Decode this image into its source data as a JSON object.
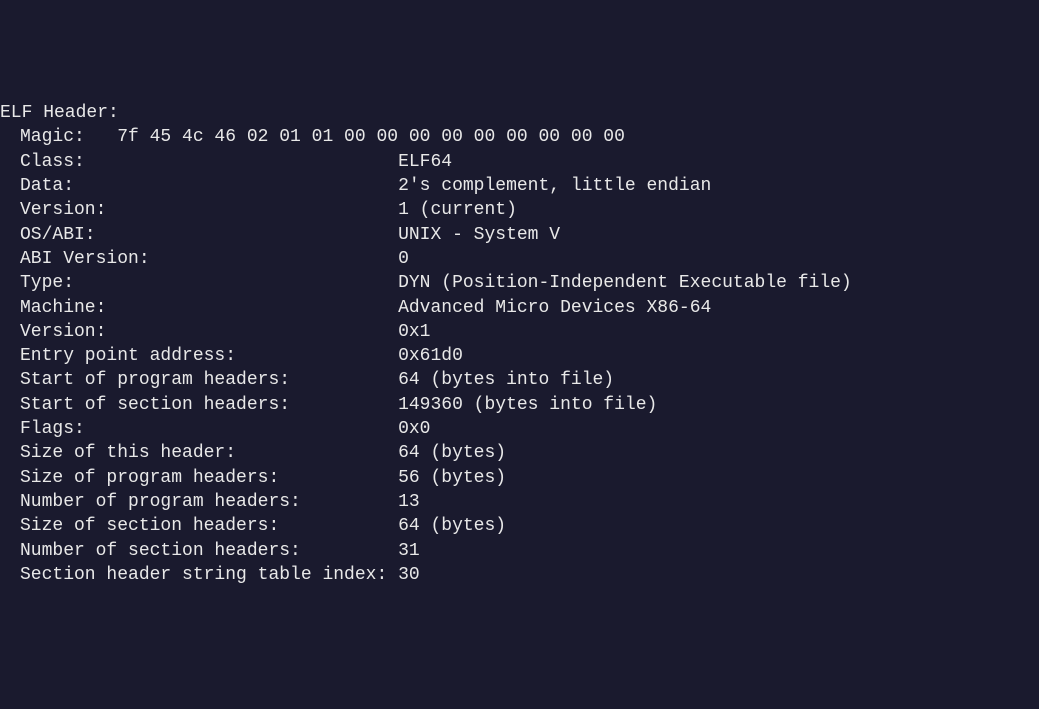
{
  "header": {
    "title": "ELF Header:"
  },
  "magic": {
    "label": "Magic:   ",
    "value": "7f 45 4c 46 02 01 01 00 00 00 00 00 00 00 00 00 "
  },
  "fields": [
    {
      "label": "Class:                             ",
      "value": "ELF64"
    },
    {
      "label": "Data:                              ",
      "value": "2's complement, little endian"
    },
    {
      "label": "Version:                           ",
      "value": "1 (current)"
    },
    {
      "label": "OS/ABI:                            ",
      "value": "UNIX - System V"
    },
    {
      "label": "ABI Version:                       ",
      "value": "0"
    },
    {
      "label": "Type:                              ",
      "value": "DYN (Position-Independent Executable file)"
    },
    {
      "label": "Machine:                           ",
      "value": "Advanced Micro Devices X86-64"
    },
    {
      "label": "Version:                           ",
      "value": "0x1"
    },
    {
      "label": "Entry point address:               ",
      "value": "0x61d0"
    },
    {
      "label": "Start of program headers:          ",
      "value": "64 (bytes into file)"
    },
    {
      "label": "Start of section headers:          ",
      "value": "149360 (bytes into file)"
    },
    {
      "label": "Flags:                             ",
      "value": "0x0"
    },
    {
      "label": "Size of this header:               ",
      "value": "64 (bytes)"
    },
    {
      "label": "Size of program headers:           ",
      "value": "56 (bytes)"
    },
    {
      "label": "Number of program headers:         ",
      "value": "13"
    },
    {
      "label": "Size of section headers:           ",
      "value": "64 (bytes)"
    },
    {
      "label": "Number of section headers:         ",
      "value": "31"
    },
    {
      "label": "Section header string table index: ",
      "value": "30"
    }
  ]
}
